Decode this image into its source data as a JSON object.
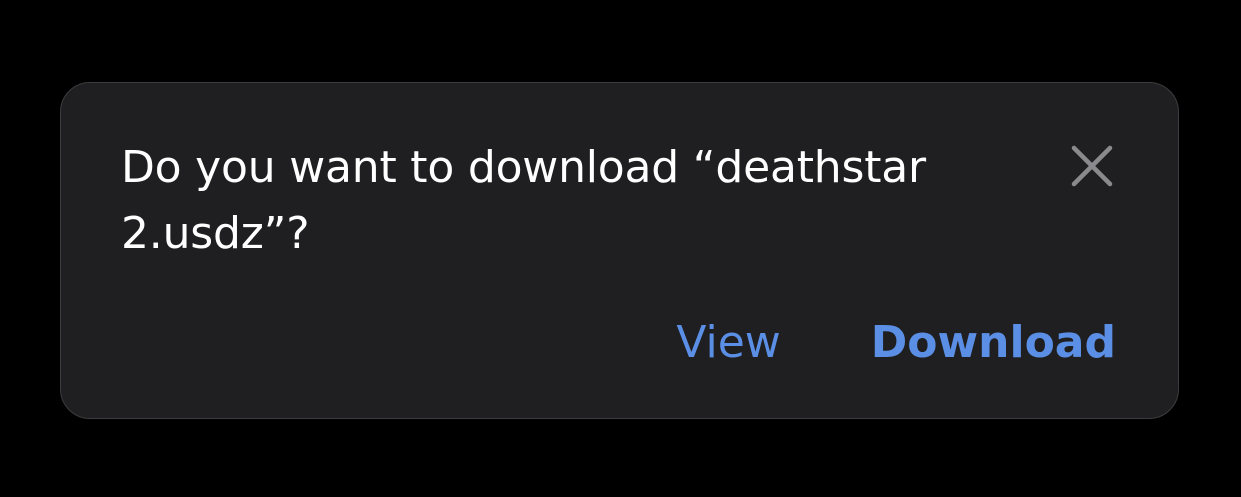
{
  "dialog": {
    "message": "Do you want to download “deathstar 2.usdz”?",
    "close_icon": "close-icon",
    "view_label": "View",
    "download_label": "Download"
  },
  "colors": {
    "background": "#000000",
    "dialog_background": "#1f1f21",
    "text": "#ffffff",
    "accent": "#5b8fe6",
    "close_icon": "#8a8a8e"
  }
}
